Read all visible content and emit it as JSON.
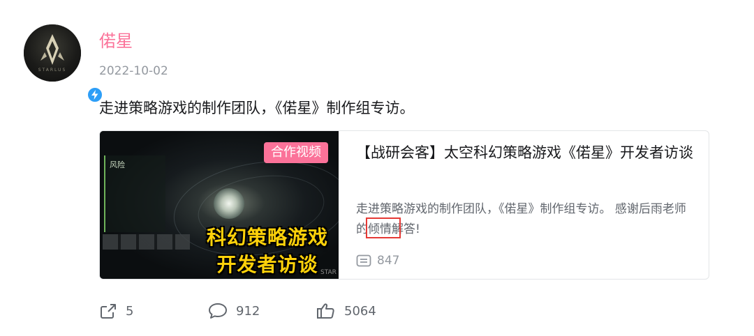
{
  "author": {
    "name": "偌星",
    "avatar_caption": "STARLUS",
    "verified_icon": "lightning-icon"
  },
  "post": {
    "date": "2022-10-02",
    "text": "走进策略游戏的制作团队，《偌星》制作组专访。"
  },
  "video_card": {
    "badge": "合作视频",
    "thumbnail_text_line1": "科幻策略游戏",
    "thumbnail_text_line2": "开发者访谈",
    "thumbnail_side_label": "风险",
    "thumbnail_mark": "STAR",
    "title": "【战研会客】太空科幻策略游戏《偌星》开发者访谈",
    "description": "走进策略游戏的制作团队，《偌星》制作组专访。 感谢后雨老师的倾情解答!",
    "comment_count": "847"
  },
  "actions": {
    "share_count": "5",
    "comment_count": "912",
    "like_count": "5064"
  },
  "colors": {
    "accent_pink": "#fb7299",
    "verify_blue": "#2d9ef7",
    "highlight_red": "#e53935",
    "thumbnail_text_yellow": "#ffd20a"
  }
}
